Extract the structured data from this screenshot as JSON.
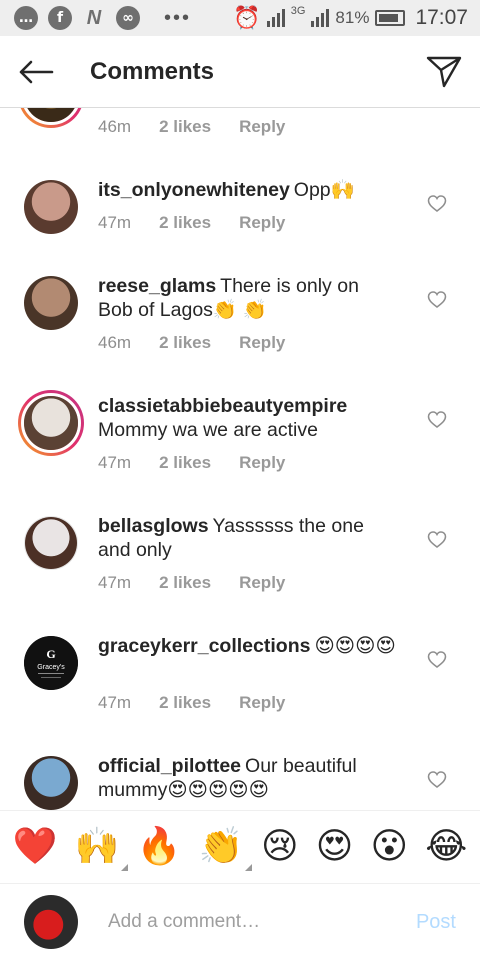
{
  "status_bar": {
    "battery": "81%",
    "time": "17:07",
    "network": "3G"
  },
  "header": {
    "title": "Comments"
  },
  "comments": [
    {
      "username": "",
      "text": "",
      "age": "46m",
      "likes": "2 likes",
      "reply": "Reply",
      "avatar_colors": [
        "#7a5a2a",
        "#3a2a18"
      ]
    },
    {
      "username": "its_onlyonewhiteney",
      "text": "Opp🙌",
      "age": "47m",
      "likes": "2 likes",
      "reply": "Reply",
      "avatar_colors": [
        "#c99a8a",
        "#5a3b2f"
      ]
    },
    {
      "username": "reese_glams",
      "text": "There is only on Bob of Lagos👏 👏",
      "age": "46m",
      "likes": "2 likes",
      "reply": "Reply",
      "avatar_colors": [
        "#b28a72",
        "#4a3528"
      ]
    },
    {
      "username": "classietabbiebeautyempire",
      "text": "Mommy wa we are active",
      "age": "47m",
      "likes": "2 likes",
      "reply": "Reply",
      "avatar_colors": [
        "#e8e2dc",
        "#5b4234"
      ]
    },
    {
      "username": "bellasglows",
      "text": "Yassssss the one and only",
      "age": "47m",
      "likes": "2 likes",
      "reply": "Reply",
      "avatar_colors": [
        "#e9e4e4",
        "#4c3026"
      ]
    },
    {
      "username": "graceykerr_collections",
      "text": "😍😍😍😍",
      "age": "47m",
      "likes": "2 likes",
      "reply": "Reply",
      "avatar_colors": [
        "#111111",
        "#111111"
      ]
    },
    {
      "username": "official_pilottee",
      "text": "Our beautiful mummy😍😍😍😍😍",
      "age": "",
      "likes": "",
      "reply": "",
      "avatar_colors": [
        "#7aa9d0",
        "#3b2b24"
      ]
    }
  ],
  "emoji_bar": [
    "❤️",
    "🙌",
    "🔥",
    "👏",
    "😢",
    "😍",
    "😮",
    "😂"
  ],
  "composer": {
    "placeholder": "Add a comment…",
    "post_label": "Post"
  },
  "avatar_logo_text": "Gracey's"
}
